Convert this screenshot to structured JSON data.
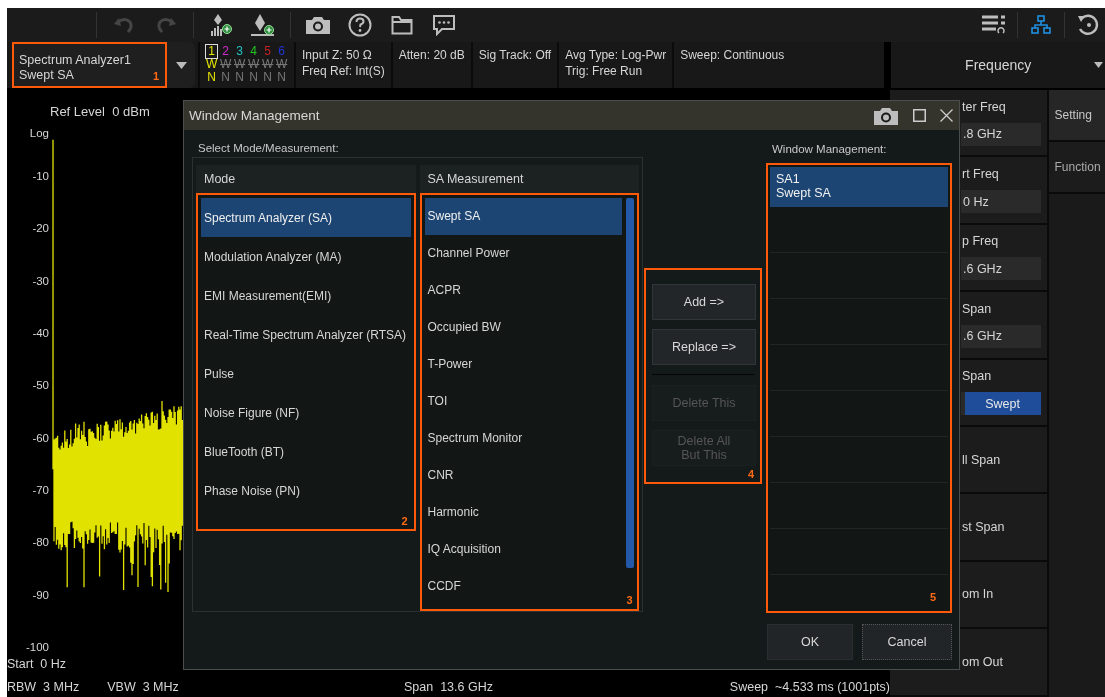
{
  "toolbar": {
    "groups": [
      {
        "items": [
          {
            "kind": "undo",
            "disabled": true
          },
          {
            "kind": "redo",
            "disabled": true
          }
        ]
      },
      {
        "items": [
          {
            "kind": "marker-bars",
            "disabled": false
          },
          {
            "kind": "marker-line",
            "disabled": false
          }
        ]
      },
      {
        "items": [
          {
            "kind": "camera",
            "disabled": false
          },
          {
            "kind": "help",
            "disabled": false
          },
          {
            "kind": "folder",
            "disabled": false
          },
          {
            "kind": "chat",
            "disabled": false
          }
        ]
      }
    ],
    "right": [
      {
        "kind": "list"
      },
      {
        "kind": "network"
      },
      {
        "kind": "restore"
      }
    ]
  },
  "instrument": {
    "mode": "Spectrum Analyzer1",
    "measurement": "Swept SA",
    "callout": "1"
  },
  "traces": [
    {
      "number": "1",
      "color": "#e6e600",
      "selected": true,
      "type": "W",
      "detector": "N",
      "on": true
    },
    {
      "number": "2",
      "color": "#d22ad2",
      "selected": false,
      "type": "W",
      "detector": "N",
      "on": false
    },
    {
      "number": "3",
      "color": "#22c4c4",
      "selected": false,
      "type": "W",
      "detector": "N",
      "on": false
    },
    {
      "number": "4",
      "color": "#22c422",
      "selected": false,
      "type": "W",
      "detector": "N",
      "on": false
    },
    {
      "number": "5",
      "color": "#c42222",
      "selected": false,
      "type": "W",
      "detector": "N",
      "on": false
    },
    {
      "number": "6",
      "color": "#2233d6",
      "selected": false,
      "type": "W",
      "detector": "N",
      "on": false
    }
  ],
  "settings": [
    {
      "lines": [
        "Input Z: 50 Ω",
        "Freq Ref: Int(S)"
      ]
    },
    {
      "lines": [
        "Atten: 20 dB"
      ]
    },
    {
      "lines": [
        "Sig Track: Off"
      ]
    },
    {
      "lines": [
        "Avg Type: Log-Pwr",
        "Trig: Free Run"
      ]
    },
    {
      "lines": [
        "Sweep: Continuous"
      ]
    }
  ],
  "graph": {
    "ref_level": "Ref Level  0 dBm",
    "y_labels": [
      "Log",
      "-10",
      "-20",
      "-30",
      "-40",
      "-50",
      "-60",
      "-70",
      "-80",
      "-90",
      "-100"
    ],
    "start": "Start  0 Hz",
    "rbw": "RBW  3 MHz",
    "vbw": "VBW  3 MHz",
    "span": "Span  13.6 GHz",
    "sweep": "Sweep  ~4.533 ms (1001pts)"
  },
  "side_panel": {
    "title": "Frequency",
    "softkeys": [
      {
        "kind": "value",
        "label": "ter Freq",
        "value": ".8 GHz"
      },
      {
        "kind": "value",
        "label": "rt Freq",
        "value": "0 Hz"
      },
      {
        "kind": "value",
        "label": "p Freq",
        "value": ".6 GHz"
      },
      {
        "kind": "value",
        "label": "Span",
        "value": ".6 GHz"
      },
      {
        "kind": "toggle",
        "label": "Span",
        "options": [
          {
            "label": "Swept",
            "selected": true
          }
        ]
      },
      {
        "kind": "plain",
        "label": "ll Span"
      },
      {
        "kind": "plain",
        "label": "st Span"
      },
      {
        "kind": "plain",
        "label": "om In"
      },
      {
        "kind": "plain",
        "label": "om Out"
      }
    ],
    "tabs": [
      {
        "label": "Setting",
        "selected": true
      },
      {
        "label": "Function",
        "selected": false
      }
    ]
  },
  "dialog": {
    "title": "Window Management",
    "select_label": "Select Mode/Measurement:",
    "mode_header": "Mode",
    "modes": [
      {
        "label": "Spectrum Analyzer (SA)",
        "selected": true
      },
      {
        "label": "Modulation Analyzer (MA)",
        "selected": false
      },
      {
        "label": "EMI Measurement(EMI)",
        "selected": false
      },
      {
        "label": "Real-Time Spectrum Analyzer (RTSA)",
        "selected": false
      },
      {
        "label": "Pulse",
        "selected": false
      },
      {
        "label": "Noise Figure (NF)",
        "selected": false
      },
      {
        "label": "BlueTooth (BT)",
        "selected": false
      },
      {
        "label": "Phase Noise (PN)",
        "selected": false
      }
    ],
    "mode_callout": "2",
    "measurement_header": "SA Measurement",
    "measurements": [
      {
        "label": "Swept SA",
        "selected": true
      },
      {
        "label": "Channel Power",
        "selected": false
      },
      {
        "label": "ACPR",
        "selected": false
      },
      {
        "label": "Occupied BW",
        "selected": false
      },
      {
        "label": "T-Power",
        "selected": false
      },
      {
        "label": "TOI",
        "selected": false
      },
      {
        "label": "Spectrum Monitor",
        "selected": false
      },
      {
        "label": "CNR",
        "selected": false
      },
      {
        "label": "Harmonic",
        "selected": false
      },
      {
        "label": "IQ Acquisition",
        "selected": false
      },
      {
        "label": "CCDF",
        "selected": false
      }
    ],
    "measurement_callout": "3",
    "actions": [
      {
        "label": "Add    =>",
        "disabled": false
      },
      {
        "label": "Replace  =>",
        "disabled": false
      },
      {
        "label": "Delete This",
        "disabled": true
      },
      {
        "label": "Delete All\nBut This",
        "disabled": true
      }
    ],
    "actions_callout": "4",
    "windows_label": "Window Management:",
    "windows": [
      {
        "lines": [
          "SA1",
          "Swept SA"
        ],
        "selected": true
      }
    ],
    "windows_callout": "5",
    "ok": "OK",
    "cancel": "Cancel"
  }
}
